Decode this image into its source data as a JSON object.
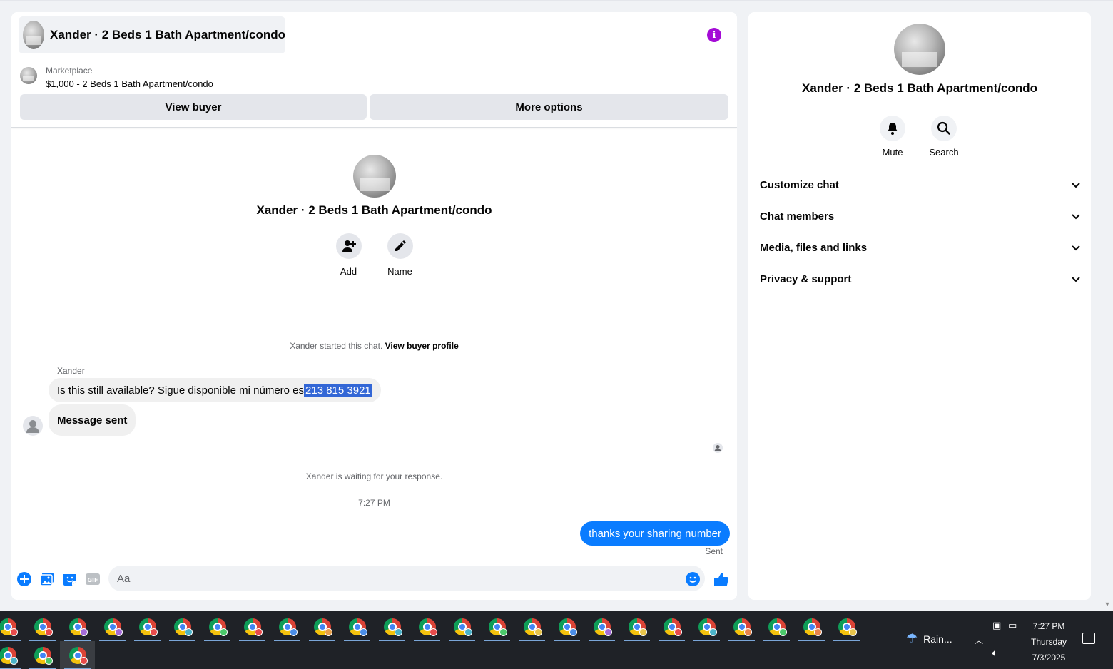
{
  "chat": {
    "title": "Xander · 2 Beds 1 Bath Apartment/condo",
    "listing_source": "Marketplace",
    "listing_price_title": "$1,000 - 2 Beds 1 Bath Apartment/condo",
    "view_buyer_label": "View buyer",
    "more_options_label": "More options",
    "profile_name": "Xander · 2 Beds 1 Bath Apartment/condo",
    "add_label": "Add",
    "name_label": "Name",
    "started_text": "Xander started this chat.",
    "view_buyer_profile": "View buyer profile",
    "sender_name": "Xander",
    "msg1_prefix": "Is this still available? Sigue disponible mi número es",
    "msg1_highlight": " 213 815 3921",
    "msg2": "Message sent",
    "waiting_text": "Xander is waiting for your response.",
    "timestamp": "7:27 PM",
    "outgoing": "thanks your sharing number",
    "sent_status": "Sent",
    "composer_placeholder": "Aa"
  },
  "info_panel": {
    "name": "Xander · 2 Beds 1 Bath Apartment/condo",
    "mute_label": "Mute",
    "search_label": "Search",
    "sections": [
      "Customize chat",
      "Chat members",
      "Media, files and links",
      "Privacy & support"
    ]
  },
  "taskbar": {
    "weather": "Rain...",
    "time": "7:27 PM",
    "day": "Thursday",
    "date": "7/3/2025"
  },
  "colors": {
    "accent": "#0a7cff",
    "info": "#a40bd6",
    "highlight": "#3367d6"
  }
}
